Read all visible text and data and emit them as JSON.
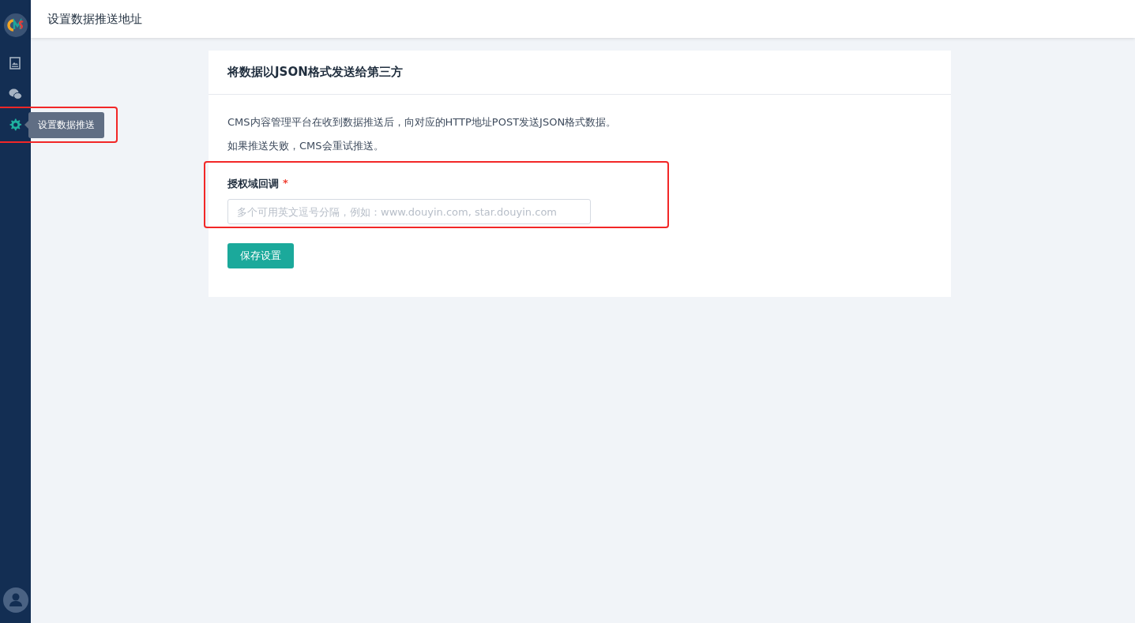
{
  "header": {
    "title": "设置数据推送地址"
  },
  "sidebar": {
    "items": [
      {
        "kind": "image",
        "selected": false
      },
      {
        "kind": "chat",
        "selected": false
      },
      {
        "kind": "settings",
        "selected": true,
        "tooltip": "设置数据推送",
        "highlighted": true
      }
    ]
  },
  "card": {
    "title": "将数据以JSON格式发送给第三方",
    "paragraphs": [
      "CMS内容管理平台在收到数据推送后，向对应的HTTP地址POST发送JSON格式数据。",
      "如果推送失败，CMS会重试推送。"
    ],
    "field": {
      "label": "授权域回调",
      "required_mark": "*",
      "placeholder": "多个可用英文逗号分隔，例如：www.douyin.com, star.douyin.com",
      "highlighted": true
    },
    "button": "保存设置"
  }
}
